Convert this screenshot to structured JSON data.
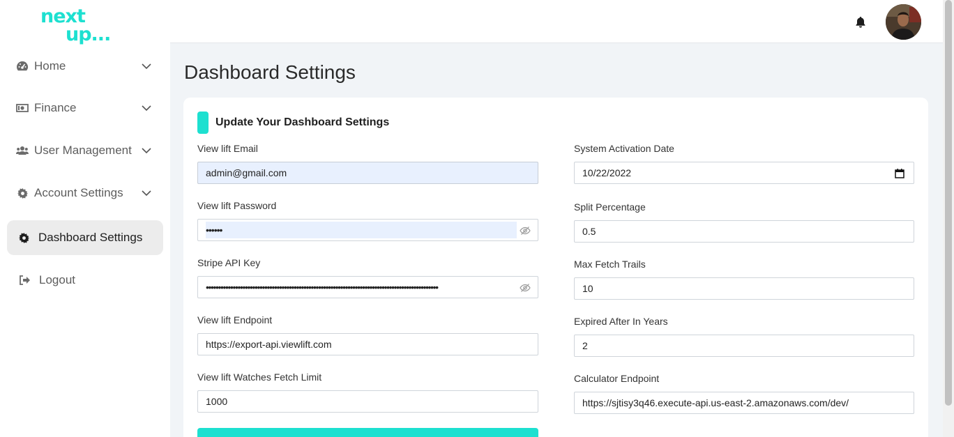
{
  "brand": {
    "logo_line1": "next",
    "logo_line2": "up...",
    "accent_color": "#1de0d0"
  },
  "sidebar": {
    "items": [
      {
        "label": "Home",
        "icon": "dashboard-gauge-icon",
        "has_chevron": true
      },
      {
        "label": "Finance",
        "icon": "money-bill-icon",
        "has_chevron": true
      },
      {
        "label": "User Management",
        "icon": "users-icon",
        "has_chevron": true
      },
      {
        "label": "Account Settings",
        "icon": "gear-icon",
        "has_chevron": true
      },
      {
        "label": "Dashboard Settings",
        "icon": "gear-icon",
        "active": true
      },
      {
        "label": "Logout",
        "icon": "sign-out-icon"
      }
    ]
  },
  "header": {
    "notification_icon": "bell-icon",
    "avatar": "user-avatar"
  },
  "page": {
    "title": "Dashboard Settings",
    "card_title": "Update Your Dashboard Settings"
  },
  "form": {
    "left": [
      {
        "label": "View lift Email",
        "value": "admin@gmail.com"
      },
      {
        "label": "View lift Password",
        "value": "••••••"
      },
      {
        "label": "Stripe API Key",
        "value": "•••••••••••••••••••••••••••••••••••••••••••••••••••••••••••••••••••••••••••••••••••••••••••••••"
      },
      {
        "label": "View lift Endpoint",
        "value": "https://export-api.viewlift.com"
      },
      {
        "label": "View lift Watches Fetch Limit",
        "value": "1000"
      }
    ],
    "right": [
      {
        "label": "System Activation Date",
        "value": "10/22/2022"
      },
      {
        "label": "Split Percentage",
        "value": "0.5"
      },
      {
        "label": "Max Fetch Trails",
        "value": "10"
      },
      {
        "label": "Expired After In Years",
        "value": "2"
      },
      {
        "label": "Calculator Endpoint",
        "value": "https://sjtisy3q46.execute-api.us-east-2.amazonaws.com/dev/"
      }
    ]
  }
}
